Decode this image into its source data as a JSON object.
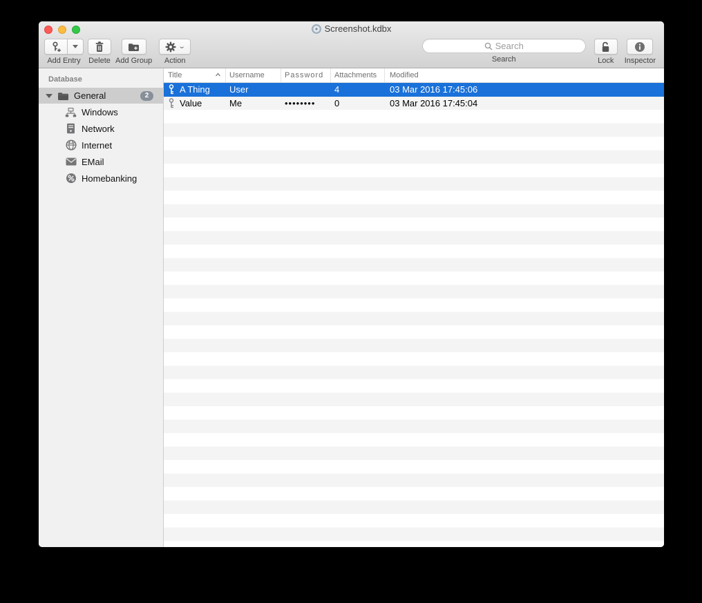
{
  "window": {
    "title": "Screenshot.kdbx"
  },
  "toolbar": {
    "add_entry_label": "Add Entry",
    "delete_label": "Delete",
    "add_group_label": "Add Group",
    "action_label": "Action",
    "search_placeholder": "Search",
    "search_label": "Search",
    "lock_label": "Lock",
    "inspector_label": "Inspector"
  },
  "sidebar": {
    "header": "Database",
    "groups": [
      {
        "label": "General",
        "badge": "2",
        "icon": "folder-icon",
        "expanded": true,
        "selected": true,
        "children": [
          {
            "label": "Windows",
            "icon": "windows-network-icon"
          },
          {
            "label": "Network",
            "icon": "server-icon"
          },
          {
            "label": "Internet",
            "icon": "globe-icon"
          },
          {
            "label": "EMail",
            "icon": "envelope-icon"
          },
          {
            "label": "Homebanking",
            "icon": "percent-circle-icon"
          }
        ]
      }
    ]
  },
  "table": {
    "columns": [
      "Title",
      "Username",
      "Password",
      "Attachments",
      "Modified"
    ],
    "sort_column": "Title",
    "sort_direction": "ascending",
    "rows": [
      {
        "title": "A Thing",
        "username": "User",
        "password": "",
        "attachments": "4",
        "modified": "03 Mar 2016 17:45:06",
        "selected": true
      },
      {
        "title": "Value",
        "username": "Me",
        "password": "••••••••",
        "attachments": "0",
        "modified": "03 Mar 2016 17:45:04",
        "selected": false
      }
    ]
  },
  "colors": {
    "selection_blue": "#1a71d9",
    "sidebar_selection_gray": "#cdcdcd",
    "row_stripe": "#f4f4f5",
    "traffic_red": "#fc5b57",
    "traffic_yellow": "#fdbc40",
    "traffic_green": "#34c848"
  }
}
